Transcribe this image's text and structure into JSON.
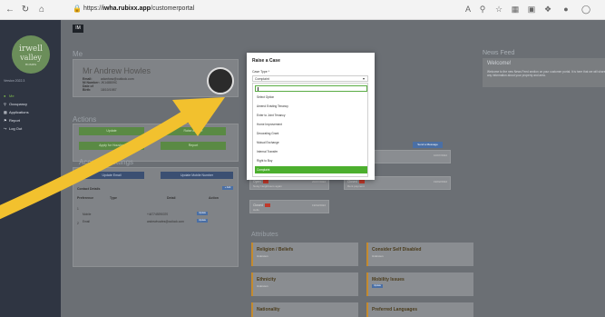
{
  "browser": {
    "url_prefix": "https://",
    "url_host": "iwha.rubixx.app",
    "url_path": "/customerportal",
    "zoom_text": "Aᴬ"
  },
  "sidebar": {
    "logo_line1": "irwell",
    "logo_line2": "valley",
    "logo_line3": "HOMES",
    "version": "Version 2022.3",
    "items": [
      {
        "label": "Me",
        "icon": "user-icon"
      },
      {
        "label": "Occupancy",
        "icon": "key-icon"
      },
      {
        "label": "Applications",
        "icon": "folder-icon"
      },
      {
        "label": "Report",
        "icon": "flag-icon"
      },
      {
        "label": "Log Out",
        "icon": "logout-icon"
      }
    ]
  },
  "top_tag": "IM",
  "me": {
    "heading": "Me",
    "name": "Mr Andrew Howles",
    "email_label": "Email:",
    "email_value": "adanhow@outlook.com",
    "ni_label": "NI Number:",
    "ni_value": "JK148809C",
    "dob_label": "Date of Birth:",
    "dob_value": "18/10/1987"
  },
  "actions": {
    "heading": "Actions",
    "buttons": [
      {
        "label": "Update"
      },
      {
        "label": "Raise a Case"
      },
      {
        "label": "Apply for Housing"
      },
      {
        "label": "Report"
      }
    ]
  },
  "account": {
    "heading": "Account Settings",
    "update_email": "Update Email",
    "update_phone": "Update Mobile Number",
    "contact_details": "Contact Details",
    "add_label": "+ Add",
    "columns": [
      "Preference",
      "Type",
      "Detail",
      "Action"
    ],
    "rows": [
      {
        "pref": "1",
        "type": "Mobile",
        "detail": "+447749290370",
        "action": "Update"
      },
      {
        "pref": "2",
        "type": "Email",
        "detail": "andrewhowles@outlook.com",
        "action": "Update"
      }
    ]
  },
  "news": {
    "heading": "News Feed",
    "card_title": "Welcome!",
    "card_text": "Welcome to the new News Feed section on your customer portal. It is here that we will share any information about your property and area."
  },
  "cases": {
    "message_button": "Send a Message",
    "items": [
      {
        "status": "Open",
        "sub": "Hello Hello",
        "date": "10/07/2022"
      },
      {
        "status": "Open",
        "sub": "Noisy Neighbours again",
        "date": "20/07/2022"
      },
      {
        "status": "Closed",
        "sub": "Rent payment",
        "date": "19/02/2022"
      },
      {
        "status": "Closed",
        "sub": "Hello",
        "date": "19/02/2022"
      },
      {
        "status": "Open",
        "sub": "Hello Hello",
        "date": ""
      }
    ]
  },
  "attributes": {
    "heading": "Attributes",
    "items": [
      {
        "title": "Religion / Beliefs",
        "value": "Unknown"
      },
      {
        "title": "Consider Self Disabled",
        "value": "Unknown"
      },
      {
        "title": "Ethnicity",
        "value": "Unknown"
      },
      {
        "title": "Mobility Issues",
        "value": "Update"
      },
      {
        "title": "Nationality",
        "value": ""
      },
      {
        "title": "Preferred Languages",
        "value": ""
      }
    ]
  },
  "modal": {
    "title": "Raise a Case",
    "field_label": "Case Type *",
    "selected": "Complaint",
    "options": [
      "Select Option",
      "Amend Existing Tenancy",
      "Enter to Joint Tenancy",
      "Home Improvement",
      "Decorating Grant",
      "Mutual Exchange",
      "Internal Transfer",
      "Right to Buy",
      "Complaint"
    ],
    "highlighted_index": 8
  },
  "colors": {
    "accent_green": "#4caf2e",
    "arrow_yellow": "#f2c12e",
    "sidebar_bg": "#2f3542"
  }
}
